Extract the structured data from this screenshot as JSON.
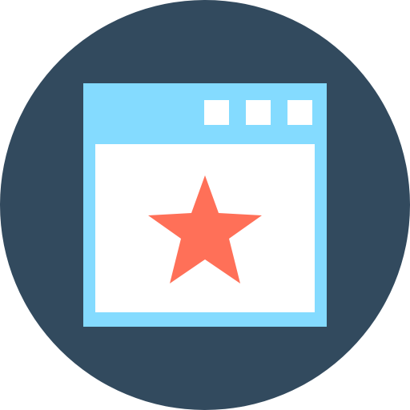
{
  "icon": {
    "semantic": "favorite-webpage-icon",
    "colors": {
      "badge": "#324A5E",
      "window_frame": "#84DBFF",
      "window_content": "#FFFFFF",
      "window_buttons": "#FFFFFF",
      "star": "#FF7058"
    },
    "window_button_count": 3
  }
}
